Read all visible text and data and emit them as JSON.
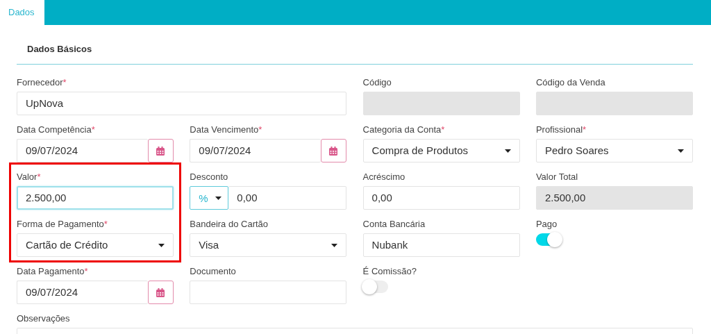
{
  "tabs": [
    {
      "label": "Dados",
      "selected": true
    }
  ],
  "section": {
    "title": "Dados Básicos"
  },
  "fields": [
    {
      "kind": "wide",
      "label": "Fornecedor",
      "mark": "*",
      "value": "UpNova"
    },
    {
      "kind": "readonly",
      "label": "Código"
    },
    {
      "kind": "readonly",
      "label": "Código da Venda"
    },
    {
      "kind": "date",
      "label": "Data Competência",
      "mark": "*",
      "value": "09/07/2024"
    },
    {
      "kind": "date",
      "label": "Data Vencimento",
      "mark": "*",
      "value": "09/07/2024"
    },
    {
      "kind": "select",
      "label": "Categoria da Conta",
      "mark": "*",
      "value": "Compra de Produtos"
    },
    {
      "kind": "select",
      "label": "Profissional",
      "mark": "*",
      "value": "Pedro Soares"
    },
    {
      "kind": "text",
      "label": "Valor",
      "mark": "*",
      "value": "2.500,00",
      "focused": true,
      "highlighted": true
    },
    {
      "kind": "combo",
      "label": "Desconto",
      "unit": "%",
      "value": "0,00"
    },
    {
      "kind": "text",
      "label": "Acréscimo",
      "value": "0,00"
    },
    {
      "kind": "readonly",
      "label": "Valor Total",
      "value": "2.500,00"
    },
    {
      "kind": "select",
      "label": "Forma de Pagamento",
      "mark": "*",
      "value": "Cartão de Crédito",
      "highlighted": true
    },
    {
      "kind": "select",
      "label": "Bandeira do Cartão",
      "value": "Visa"
    },
    {
      "kind": "text",
      "label": "Conta Bancária",
      "value": "Nubank"
    },
    {
      "kind": "toggle",
      "label": "Pago",
      "on": true
    },
    {
      "kind": "date",
      "label": "Data Pagamento",
      "mark": "*",
      "value": "09/07/2024"
    },
    {
      "kind": "text",
      "label": "Documento"
    },
    {
      "kind": "toggle",
      "label": "É Comissão?",
      "on": false
    },
    {
      "kind": "spacer"
    },
    {
      "kind": "textarea",
      "label": "Observações"
    }
  ]
}
